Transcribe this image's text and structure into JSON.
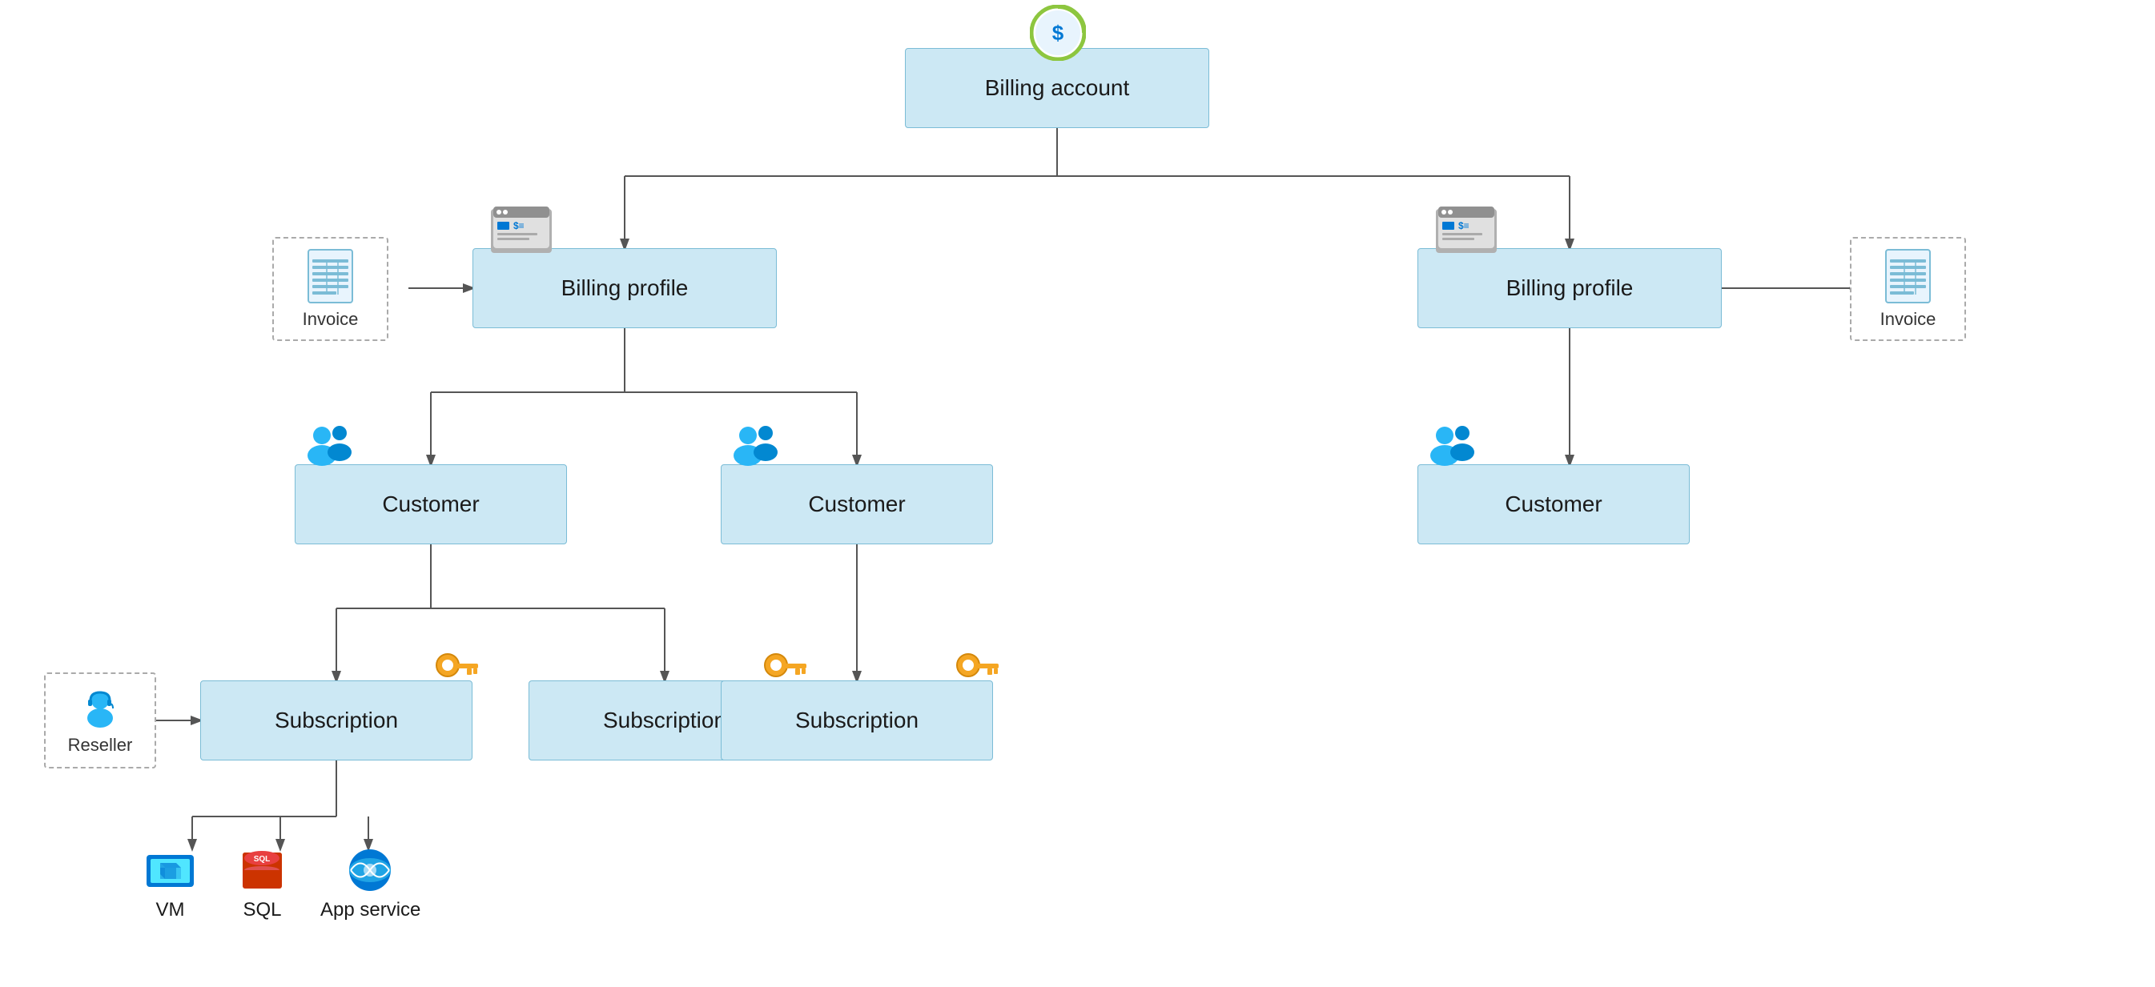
{
  "nodes": {
    "billing_account": {
      "label": "Billing account"
    },
    "billing_profile_left": {
      "label": "Billing profile"
    },
    "billing_profile_right": {
      "label": "Billing profile"
    },
    "customer_1": {
      "label": "Customer"
    },
    "customer_2": {
      "label": "Customer"
    },
    "customer_3": {
      "label": "Customer"
    },
    "subscription_1": {
      "label": "Subscription"
    },
    "subscription_2": {
      "label": "Subscription"
    },
    "subscription_3": {
      "label": "Subscription"
    },
    "reseller": {
      "label": "Reseller"
    },
    "invoice_left": {
      "label": "Invoice"
    },
    "invoice_right": {
      "label": "Invoice"
    },
    "vm": {
      "label": "VM"
    },
    "sql": {
      "label": "SQL"
    },
    "appservice": {
      "label": "App service"
    }
  },
  "colors": {
    "node_bg": "#cce8f4",
    "node_border": "#7bbcd6",
    "dashed_border": "#aaaaaa",
    "line_color": "#555555"
  }
}
